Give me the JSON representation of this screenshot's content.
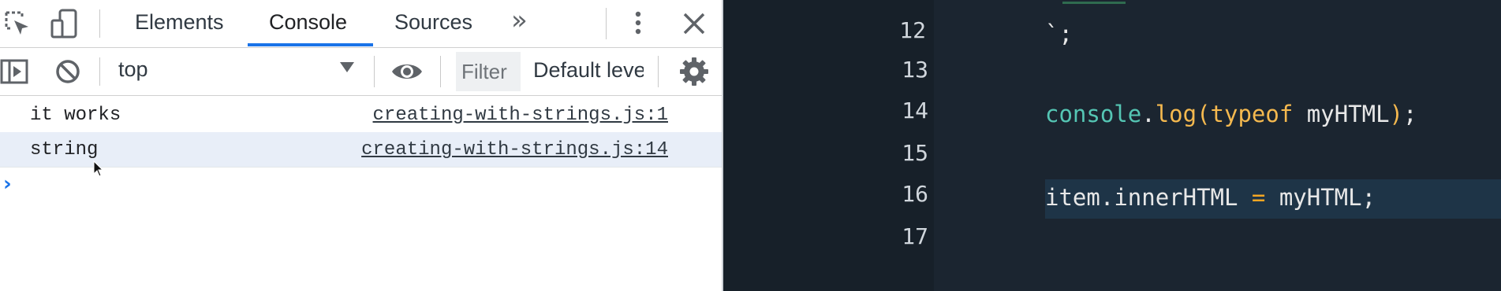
{
  "devtools": {
    "tabs": [
      {
        "label": "Elements"
      },
      {
        "label": "Console"
      },
      {
        "label": "Sources"
      }
    ],
    "more_tabs": "»",
    "toolbar": {
      "context": "top",
      "filter_placeholder": "Filter",
      "levels": "Default leve"
    },
    "console": {
      "rows": [
        {
          "message": "it works",
          "source": "creating-with-strings.js:1"
        },
        {
          "message": "string",
          "source": "creating-with-strings.js:14"
        }
      ],
      "prompt": "›"
    }
  },
  "editor": {
    "lines": [
      {
        "number": "12",
        "code_text": "`;"
      },
      {
        "number": "13",
        "code_text": ""
      },
      {
        "number": "14",
        "tokens": [
          "console",
          ".",
          "log",
          "(",
          "typeof",
          " myHTML",
          ")",
          ";"
        ]
      },
      {
        "number": "15",
        "code_text": ""
      },
      {
        "number": "16",
        "tokens": [
          "item",
          ".",
          "innerHTML",
          " = ",
          "myHTML",
          ";"
        ]
      },
      {
        "number": "17",
        "code_text": ""
      }
    ]
  },
  "colors": {
    "accent": "#1a73e8",
    "editor_bg": "#1b2530",
    "gutter_bg": "#172029",
    "highlight_line": "#1e3447",
    "function_token": "#55c6b4",
    "keyword_token": "#f5b94f",
    "operator_token": "#f5a623"
  }
}
